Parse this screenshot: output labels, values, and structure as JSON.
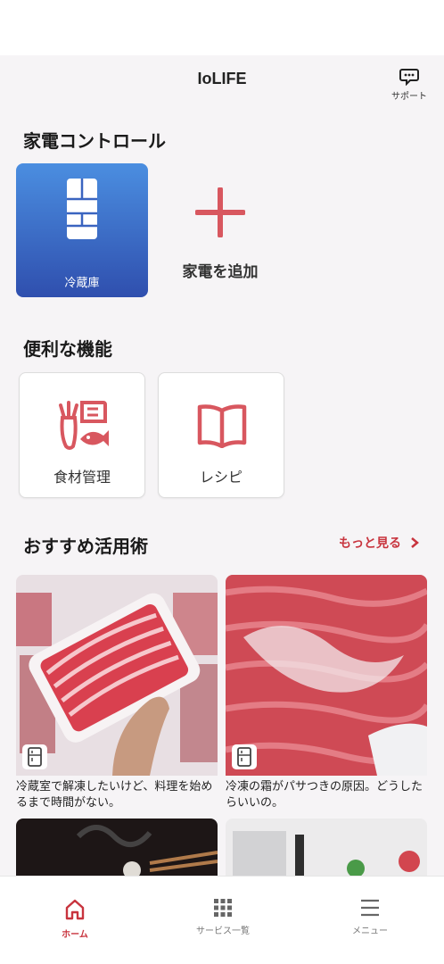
{
  "header": {
    "title": "IoLIFE",
    "support_label": "サポート"
  },
  "appliance_control": {
    "title": "家電コントロール",
    "fridge_label": "冷蔵庫",
    "add_label": "家電を追加"
  },
  "features": {
    "title": "便利な機能",
    "items": [
      {
        "label": "食材管理",
        "icon": "food-management-icon"
      },
      {
        "label": "レシピ",
        "icon": "recipe-book-icon"
      }
    ]
  },
  "recommended": {
    "title": "おすすめ活用術",
    "more_label": "もっと見る",
    "articles": [
      {
        "caption": "冷蔵室で解凍したいけど、料理を始めるまで時間がない。"
      },
      {
        "caption": "冷凍の霜がパサつきの原因。どうしたらいいの。"
      }
    ]
  },
  "bottom_nav": {
    "items": [
      {
        "label": "ホーム",
        "icon": "home-icon",
        "active": true
      },
      {
        "label": "サービス一覧",
        "icon": "grid-icon",
        "active": false
      },
      {
        "label": "メニュー",
        "icon": "menu-icon",
        "active": false
      }
    ]
  },
  "colors": {
    "accent": "#c8343e",
    "card_blue_top": "#4b8ee0",
    "card_blue_bottom": "#2f4fae",
    "background": "#f6f4f6"
  }
}
